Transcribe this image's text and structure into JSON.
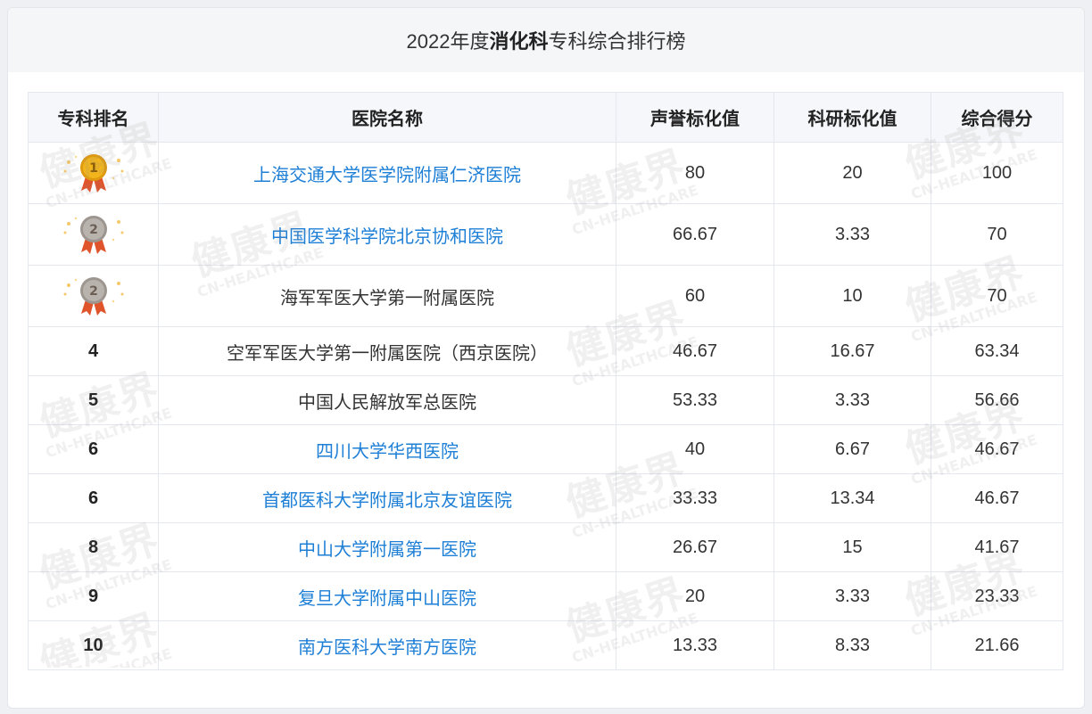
{
  "page": {
    "title_prefix": "2022年度",
    "title_highlight": "消化科",
    "title_suffix": "专科综合排行榜"
  },
  "table": {
    "headers": [
      "专科排名",
      "医院名称",
      "声誉标化值",
      "科研标化值",
      "综合得分"
    ],
    "rows": [
      {
        "rank": "1",
        "rank_display": "medal-gold-1",
        "hospital": "上海交通大学医学院附属仁济医院",
        "linked": true,
        "reputation": "80",
        "research": "20",
        "total": "100"
      },
      {
        "rank": "2",
        "rank_display": "medal-silver-2",
        "hospital": "中国医学科学院北京协和医院",
        "linked": true,
        "reputation": "66.67",
        "research": "3.33",
        "total": "70"
      },
      {
        "rank": "2",
        "rank_display": "medal-silver-2",
        "hospital": "海军军医大学第一附属医院",
        "linked": false,
        "reputation": "60",
        "research": "10",
        "total": "70"
      },
      {
        "rank": "4",
        "hospital": "空军军医大学第一附属医院（西京医院）",
        "linked": false,
        "reputation": "46.67",
        "research": "16.67",
        "total": "63.34"
      },
      {
        "rank": "5",
        "hospital": "中国人民解放军总医院",
        "linked": false,
        "reputation": "53.33",
        "research": "3.33",
        "total": "56.66"
      },
      {
        "rank": "6",
        "hospital": "四川大学华西医院",
        "linked": true,
        "reputation": "40",
        "research": "6.67",
        "total": "46.67"
      },
      {
        "rank": "6",
        "hospital": "首都医科大学附属北京友谊医院",
        "linked": true,
        "reputation": "33.33",
        "research": "13.34",
        "total": "46.67"
      },
      {
        "rank": "8",
        "hospital": "中山大学附属第一医院",
        "linked": true,
        "reputation": "26.67",
        "research": "15",
        "total": "41.67"
      },
      {
        "rank": "9",
        "hospital": "复旦大学附属中山医院",
        "linked": true,
        "reputation": "20",
        "research": "3.33",
        "total": "23.33"
      },
      {
        "rank": "10",
        "hospital": "南方医科大学南方医院",
        "linked": true,
        "reputation": "13.33",
        "research": "8.33",
        "total": "21.66"
      }
    ]
  },
  "watermark": {
    "text_cn": "健康界",
    "text_en": "CN-HEALTHCARE"
  },
  "colors": {
    "link": "#1e7fd6",
    "gold": "#f2b51c",
    "silver": "#b9b3ae",
    "ribbon": "#e0542c"
  }
}
